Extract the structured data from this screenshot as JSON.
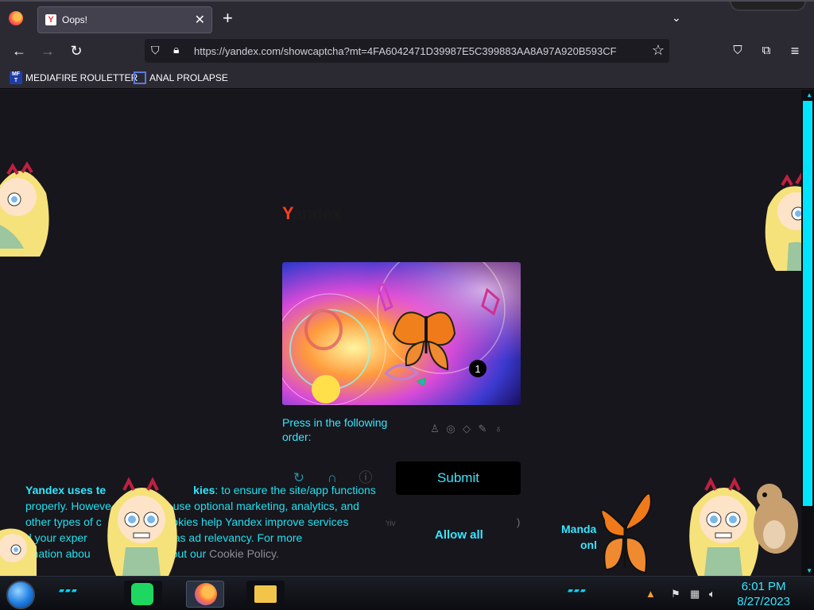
{
  "browser": {
    "tab_title": "Oops!",
    "tab_favicon": "Y",
    "url": "https://yandex.com/showcaptcha?mt=4FA6042471D39987E5C399883AA8A97A920B593CF",
    "bookmarks": [
      {
        "label": "MEDIAFIRE ROULETTER",
        "icon": "mf-icon"
      },
      {
        "label": "ANAL PROLAPSE",
        "icon": "bookmark-icon"
      }
    ]
  },
  "page": {
    "logo_first": "Y",
    "logo_rest": "andex",
    "prompt": "Press in the following order:",
    "captcha_badge": "1",
    "submit_label": "Submit",
    "cookie_bold": "Yandex uses te",
    "cookie_bold_end": "kies",
    "cookie_line1": ": to ensure the site/app functions",
    "cookie_line2": "properly. Howeve                 o use optional marketing, analytics, and",
    "cookie_line3": "other types of c                e cookies help Yandex improve services",
    "cookie_line4": "d your exper           m, as well as ad relevancy. For more",
    "cookie_line5": "rmation abou          es, check out our ",
    "cookie_link": "Cookie Policy.",
    "privacy_fragment": "'riv",
    "paren_fragment": ")",
    "allow_all": "Allow all",
    "mandatory_line1": "Manda",
    "mandatory_line2": "onl",
    "v_fragment": "V"
  },
  "taskbar": {
    "time": "6:01 PM",
    "date": "8/27/2023"
  },
  "colors": {
    "accent": "#39e6ff",
    "page_bg": "#17161c",
    "browser_bg": "#2b2a33",
    "yandex_red": "#fc3f1d"
  }
}
